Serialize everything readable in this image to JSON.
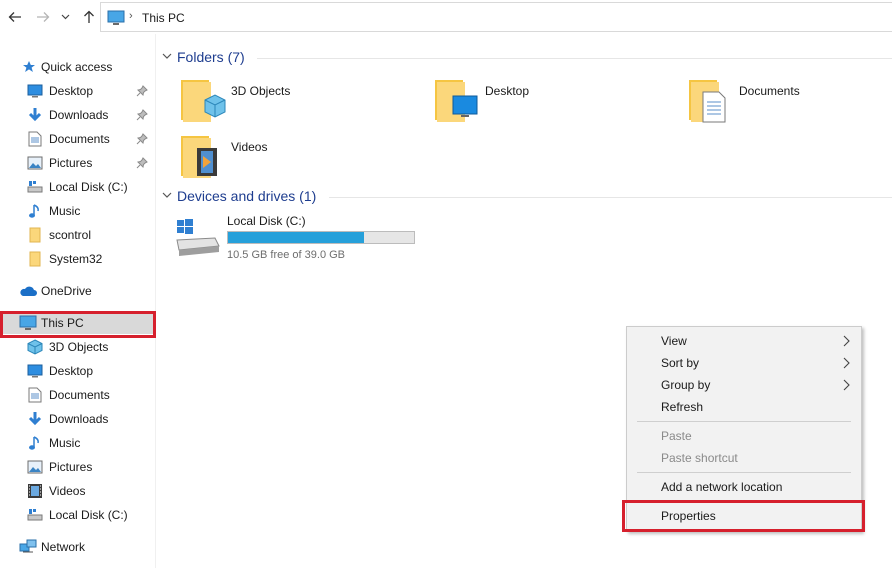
{
  "address": {
    "path_label": "This PC",
    "separator": "›"
  },
  "colors": {
    "accent": "#1e3d8f",
    "highlight": "#d6202d",
    "drive_fill": "#26a0da",
    "selected_bg": "#d9d9d9"
  },
  "sidebar": {
    "quick_access": "Quick access",
    "quick_items": [
      {
        "label": "Desktop",
        "icon": "desktop-icon",
        "pinned": true
      },
      {
        "label": "Downloads",
        "icon": "downloads-icon",
        "pinned": true
      },
      {
        "label": "Documents",
        "icon": "documents-icon",
        "pinned": true
      },
      {
        "label": "Pictures",
        "icon": "pictures-icon",
        "pinned": true
      },
      {
        "label": "Local Disk (C:)",
        "icon": "drive-icon",
        "pinned": false
      },
      {
        "label": "Music",
        "icon": "music-icon",
        "pinned": false
      },
      {
        "label": "scontrol",
        "icon": "folder-icon",
        "pinned": false
      },
      {
        "label": "System32",
        "icon": "folder-icon",
        "pinned": false
      }
    ],
    "onedrive": "OneDrive",
    "this_pc": "This PC",
    "pc_items": [
      {
        "label": "3D Objects",
        "icon": "3d-objects-icon"
      },
      {
        "label": "Desktop",
        "icon": "desktop-icon"
      },
      {
        "label": "Documents",
        "icon": "documents-icon"
      },
      {
        "label": "Downloads",
        "icon": "downloads-icon"
      },
      {
        "label": "Music",
        "icon": "music-icon"
      },
      {
        "label": "Pictures",
        "icon": "pictures-icon"
      },
      {
        "label": "Videos",
        "icon": "videos-icon"
      },
      {
        "label": "Local Disk (C:)",
        "icon": "drive-icon"
      }
    ],
    "network": "Network"
  },
  "main": {
    "folders_header": "Folders (7)",
    "folders": [
      {
        "label": "3D Objects",
        "icon": "3d-objects-folder-icon"
      },
      {
        "label": "Desktop",
        "icon": "desktop-folder-icon"
      },
      {
        "label": "Documents",
        "icon": "documents-folder-icon"
      },
      {
        "label": "Videos",
        "icon": "videos-folder-icon"
      }
    ],
    "devices_header": "Devices and drives (1)",
    "drive": {
      "label": "Local Disk (C:)",
      "free_text": "10.5 GB free of 39.0 GB",
      "used_fraction": 0.73
    }
  },
  "context_menu": {
    "items": [
      {
        "label": "View",
        "submenu": true,
        "disabled": false
      },
      {
        "label": "Sort by",
        "submenu": true,
        "disabled": false
      },
      {
        "label": "Group by",
        "submenu": true,
        "disabled": false
      },
      {
        "label": "Refresh",
        "submenu": false,
        "disabled": false
      },
      {
        "label": "Paste",
        "submenu": false,
        "disabled": true
      },
      {
        "label": "Paste shortcut",
        "submenu": false,
        "disabled": true
      },
      {
        "label": "Add a network location",
        "submenu": false,
        "disabled": false
      },
      {
        "label": "Properties",
        "submenu": false,
        "disabled": false
      }
    ]
  }
}
